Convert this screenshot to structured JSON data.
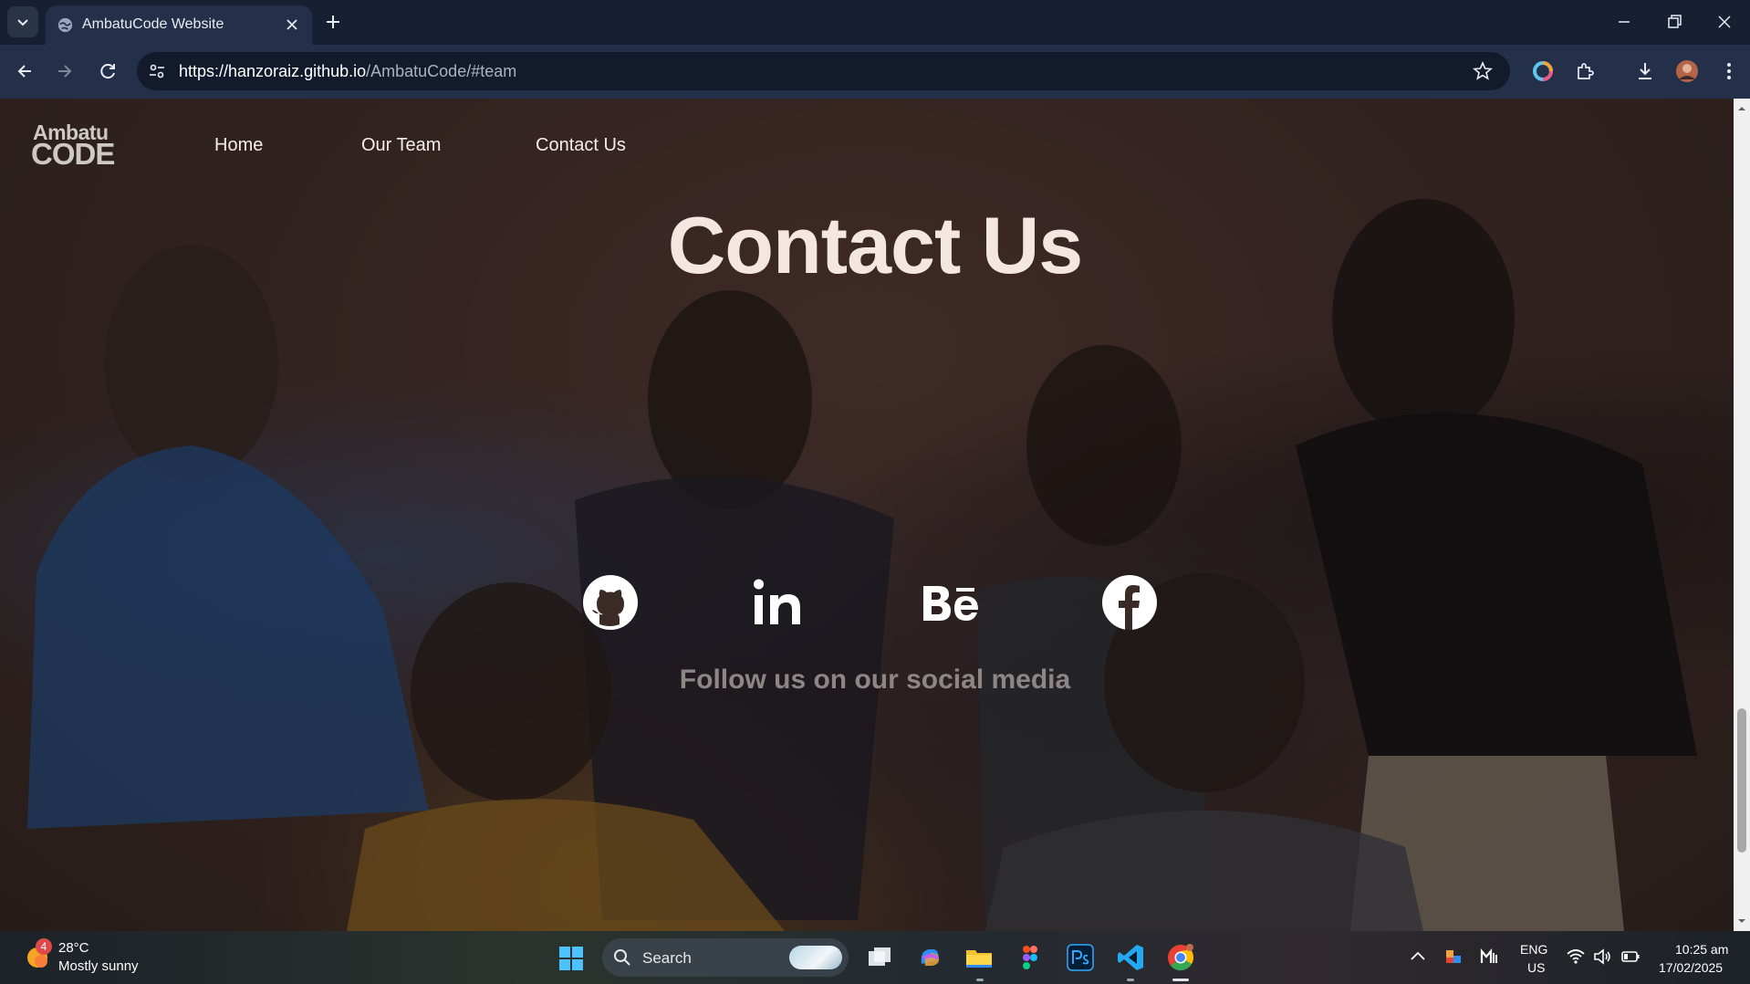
{
  "browser": {
    "tab_title": "AmbatuCode Website",
    "url_host": "https://hanzoraiz.github.io",
    "url_path": "/AmbatuCode/#team"
  },
  "site": {
    "logo_line1": "Ambatu",
    "logo_line2": "CODE",
    "nav": [
      "Home",
      "Our Team",
      "Contact Us"
    ],
    "heading": "Contact Us",
    "social": [
      "github-icon",
      "linkedin-icon",
      "behance-icon",
      "facebook-icon"
    ],
    "follow_text": "Follow us on our social media"
  },
  "taskbar": {
    "weather_badge": "4",
    "weather_temp": "28°C",
    "weather_desc": "Mostly sunny",
    "search_label": "Search",
    "lang_line1": "ENG",
    "lang_line2": "US",
    "time": "10:25 am",
    "date": "17/02/2025"
  }
}
